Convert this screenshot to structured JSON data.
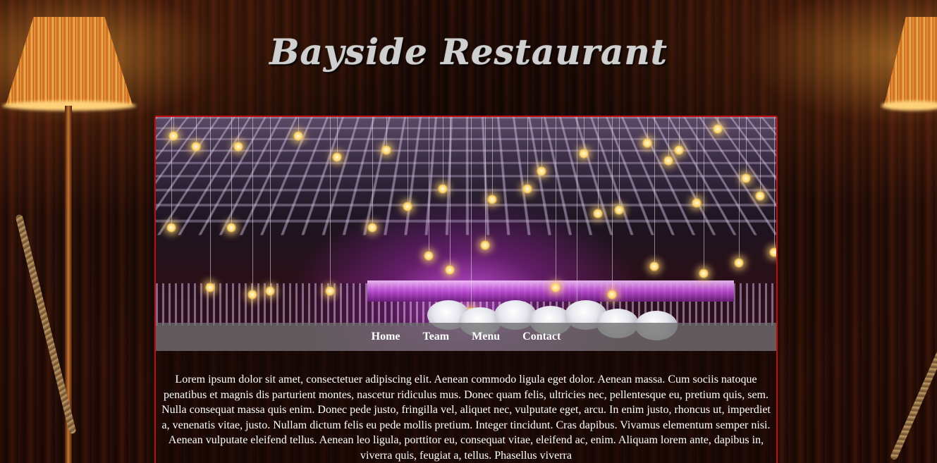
{
  "site": {
    "title": "Bayside Restaurant"
  },
  "nav": {
    "items": [
      {
        "label": "Home"
      },
      {
        "label": "Team"
      },
      {
        "label": "Menu"
      },
      {
        "label": "Contact"
      }
    ]
  },
  "main": {
    "hero_image_alt": "restaurant interior with hanging lights",
    "body_text": "Lorem ipsum dolor sit amet, consectetuer adipiscing elit. Aenean commodo ligula eget dolor. Aenean massa. Cum sociis natoque penatibus et magnis dis parturient montes, nascetur ridiculus mus. Donec quam felis, ultricies nec, pellentesque eu, pretium quis, sem. Nulla consequat massa quis enim. Donec pede justo, fringilla vel, aliquet nec, vulputate eget, arcu. In enim justo, rhoncus ut, imperdiet a, venenatis vitae, justo. Nullam dictum felis eu pede mollis pretium. Integer tincidunt. Cras dapibus. Vivamus elementum semper nisi. Aenean vulputate eleifend tellus. Aenean leo ligula, porttitor eu, consequat vitae, eleifend ac, enim. Aliquam lorem ante, dapibus in, viverra quis, feugiat a, tellus. Phasellus viverra"
  },
  "colors": {
    "container_border": "#c00d0d",
    "nav_background": "#6e6e6e",
    "text": "#ffffff",
    "title": "#cfcfcf"
  },
  "icons": [
    "lamp-left-decoration",
    "lamp-right-decoration"
  ]
}
